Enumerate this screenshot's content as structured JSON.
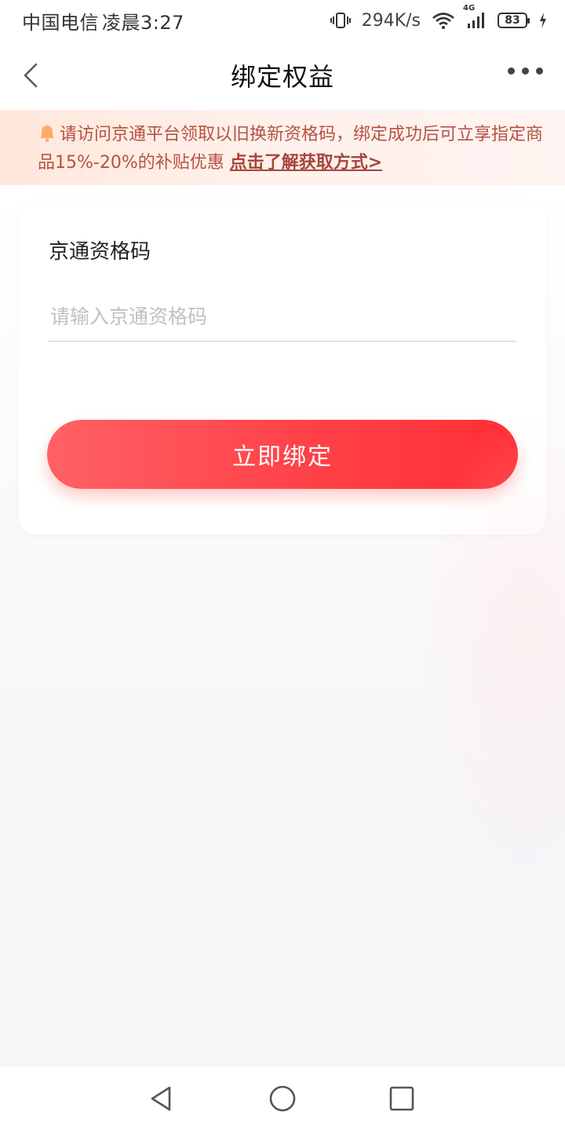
{
  "status_bar": {
    "carrier": "中国电信",
    "time": "凌晨3:27",
    "net_speed": "294K/s",
    "network_type": "4G",
    "battery": "83"
  },
  "nav": {
    "title": "绑定权益"
  },
  "notice": {
    "text": "请访问京通平台领取以旧换新资格码，绑定成功后可立享指定商品15%-20%的补贴优惠",
    "link": "点击了解获取方式>"
  },
  "form": {
    "label": "京通资格码",
    "placeholder": "请输入京通资格码",
    "value": "",
    "submit_label": "立即绑定"
  },
  "colors": {
    "accent": "#ff3b3f",
    "notice_text": "#b65242",
    "notice_bg": "#ffe8dc"
  }
}
